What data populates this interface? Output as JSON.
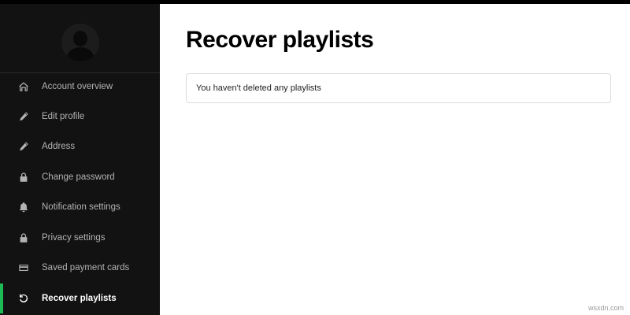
{
  "sidebar": {
    "items": [
      {
        "label": "Account overview",
        "icon": "home-icon"
      },
      {
        "label": "Edit profile",
        "icon": "pencil-icon"
      },
      {
        "label": "Address",
        "icon": "pencil-icon"
      },
      {
        "label": "Change password",
        "icon": "lock-icon"
      },
      {
        "label": "Notification settings",
        "icon": "bell-icon"
      },
      {
        "label": "Privacy settings",
        "icon": "lock-icon"
      },
      {
        "label": "Saved payment cards",
        "icon": "credit-card-icon"
      },
      {
        "label": "Recover playlists",
        "icon": "recover-icon",
        "active": true
      }
    ]
  },
  "main": {
    "title": "Recover playlists",
    "message": "You haven't deleted any playlists"
  },
  "watermark": "wsxdn.com",
  "colors": {
    "sidebar_bg": "#121212",
    "accent": "#1db954",
    "main_bg": "#ffffff"
  }
}
